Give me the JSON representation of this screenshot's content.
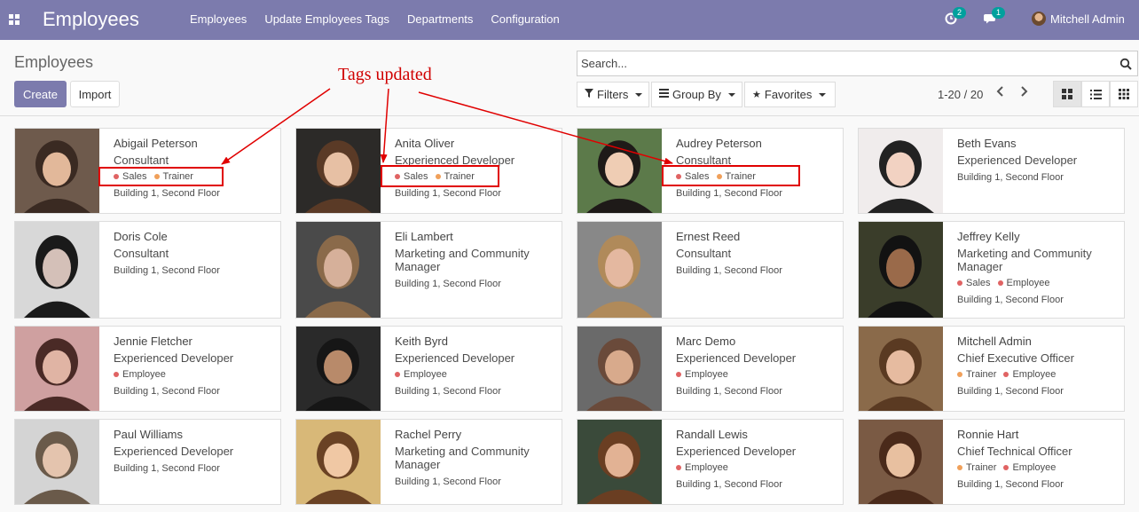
{
  "navbar": {
    "app_title": "Employees",
    "menu": [
      "Employees",
      "Update Employees Tags",
      "Departments",
      "Configuration"
    ],
    "activity_badge": "2",
    "messages_badge": "1",
    "user_name": "Mitchell Admin",
    "bg_color": "#7c7bad"
  },
  "control_panel": {
    "title": "Employees",
    "create_label": "Create",
    "import_label": "Import",
    "search_placeholder": "Search...",
    "filters_label": "Filters",
    "group_by_label": "Group By",
    "favorites_label": "Favorites",
    "pager": "1-20 / 20",
    "active_view": "kanban"
  },
  "annotation": {
    "text": "Tags updated",
    "color": "#e00000"
  },
  "tag_colors": {
    "Sales": "#e06363",
    "Trainer": "#f0a05a",
    "Employee": "#e06363"
  },
  "employees": [
    {
      "name": "Abigail Peterson",
      "job": "Consultant",
      "tags": [
        "Sales",
        "Trainer"
      ],
      "location": "Building 1, Second Floor"
    },
    {
      "name": "Anita Oliver",
      "job": "Experienced Developer",
      "tags": [
        "Sales",
        "Trainer"
      ],
      "location": "Building 1, Second Floor"
    },
    {
      "name": "Audrey Peterson",
      "job": "Consultant",
      "tags": [
        "Sales",
        "Trainer"
      ],
      "location": "Building 1, Second Floor"
    },
    {
      "name": "Beth Evans",
      "job": "Experienced Developer",
      "tags": [],
      "location": "Building 1, Second Floor"
    },
    {
      "name": "Doris Cole",
      "job": "Consultant",
      "tags": [],
      "location": "Building 1, Second Floor"
    },
    {
      "name": "Eli Lambert",
      "job": "Marketing and Community Manager",
      "tags": [],
      "location": "Building 1, Second Floor"
    },
    {
      "name": "Ernest Reed",
      "job": "Consultant",
      "tags": [],
      "location": "Building 1, Second Floor"
    },
    {
      "name": "Jeffrey Kelly",
      "job": "Marketing and Community Manager",
      "tags": [
        "Sales",
        "Employee"
      ],
      "location": "Building 1, Second Floor"
    },
    {
      "name": "Jennie Fletcher",
      "job": "Experienced Developer",
      "tags": [
        "Employee"
      ],
      "location": "Building 1, Second Floor"
    },
    {
      "name": "Keith Byrd",
      "job": "Experienced Developer",
      "tags": [
        "Employee"
      ],
      "location": "Building 1, Second Floor"
    },
    {
      "name": "Marc Demo",
      "job": "Experienced Developer",
      "tags": [
        "Employee"
      ],
      "location": "Building 1, Second Floor"
    },
    {
      "name": "Mitchell Admin",
      "job": "Chief Executive Officer",
      "tags": [
        "Trainer",
        "Employee"
      ],
      "location": "Building 1, Second Floor"
    },
    {
      "name": "Paul Williams",
      "job": "Experienced Developer",
      "tags": [],
      "location": "Building 1, Second Floor"
    },
    {
      "name": "Rachel Perry",
      "job": "Marketing and Community Manager",
      "tags": [],
      "location": "Building 1, Second Floor"
    },
    {
      "name": "Randall Lewis",
      "job": "Experienced Developer",
      "tags": [
        "Employee"
      ],
      "location": "Building 1, Second Floor"
    },
    {
      "name": "Ronnie Hart",
      "job": "Chief Technical Officer",
      "tags": [
        "Trainer",
        "Employee"
      ],
      "location": "Building 1, Second Floor"
    }
  ]
}
